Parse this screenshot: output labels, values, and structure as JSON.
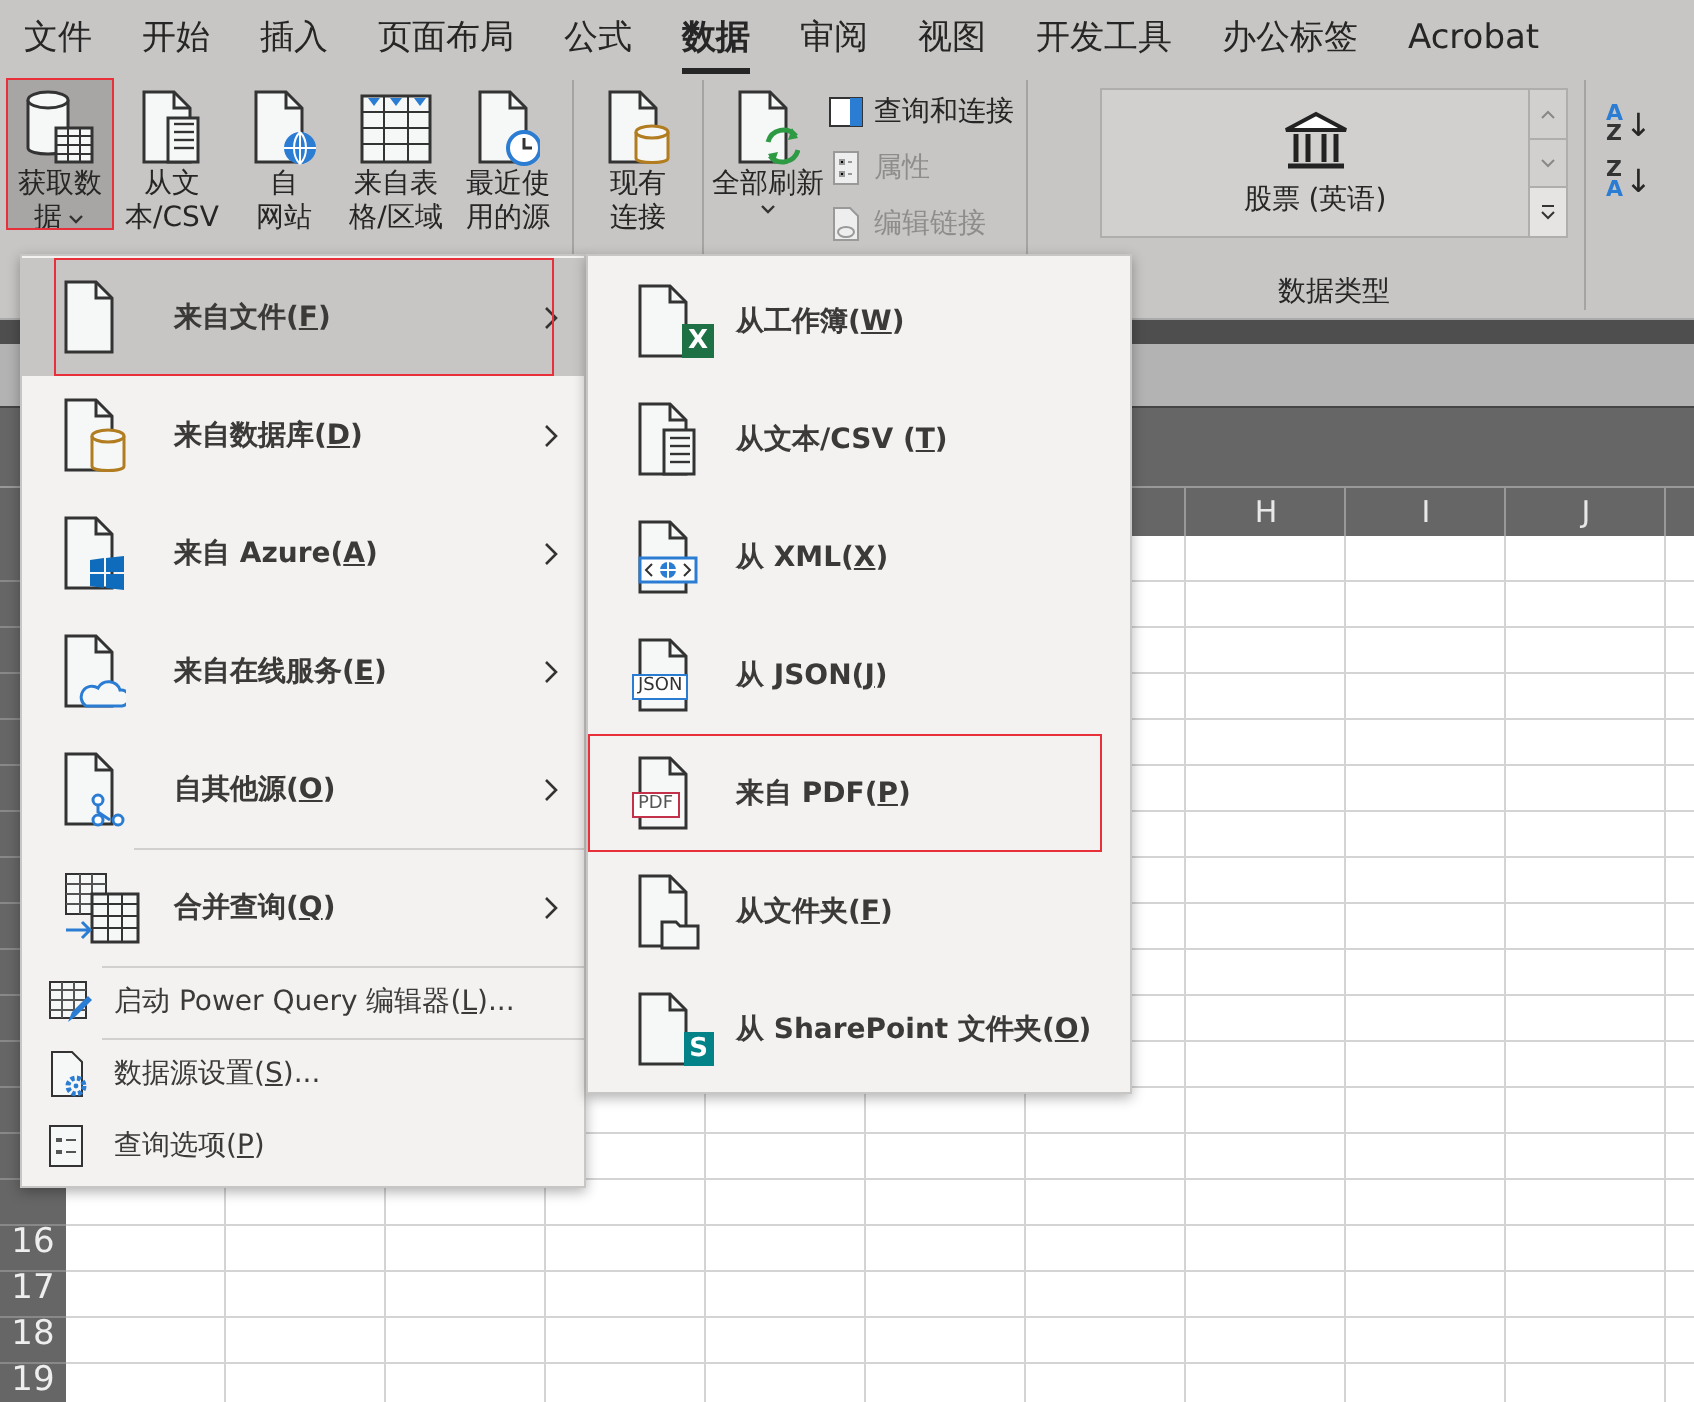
{
  "tabs": [
    {
      "label": "文件",
      "selected": false
    },
    {
      "label": "开始",
      "selected": false
    },
    {
      "label": "插入",
      "selected": false
    },
    {
      "label": "页面布局",
      "selected": false
    },
    {
      "label": "公式",
      "selected": false
    },
    {
      "label": "数据",
      "selected": true
    },
    {
      "label": "审阅",
      "selected": false
    },
    {
      "label": "视图",
      "selected": false
    },
    {
      "label": "开发工具",
      "selected": false
    },
    {
      "label": "办公标签",
      "selected": false
    },
    {
      "label": "Acrobat",
      "selected": false
    }
  ],
  "ribbon": {
    "groups": [
      {
        "buttons": [
          {
            "lines": [
              "获取数",
              "据"
            ],
            "dropdown": true,
            "selected": true,
            "outlined": true
          },
          {
            "lines": [
              "从文",
              "本/CSV"
            ],
            "dropdown": false,
            "selected": false,
            "outlined": false
          },
          {
            "lines": [
              "自",
              "网站"
            ],
            "dropdown": false,
            "selected": false,
            "outlined": false
          },
          {
            "lines": [
              "来自表",
              "格/区域"
            ],
            "dropdown": false,
            "selected": false,
            "outlined": false
          },
          {
            "lines": [
              "最近使",
              "用的源"
            ],
            "dropdown": false,
            "selected": false,
            "outlined": false
          }
        ]
      },
      {
        "buttons": [
          {
            "lines": [
              "现有",
              "连接"
            ],
            "dropdown": false,
            "selected": false,
            "outlined": false
          }
        ]
      },
      {
        "buttons": [
          {
            "lines": [
              "全部刷新"
            ],
            "dropdown": true,
            "selected": false,
            "outlined": false
          }
        ],
        "small_buttons": [
          {
            "label": "查询和连接",
            "disabled": false
          },
          {
            "label": "属性",
            "disabled": true
          },
          {
            "label": "编辑链接",
            "disabled": true
          }
        ]
      }
    ],
    "data_types": {
      "item": "股票 (英语)",
      "label": "数据类型"
    },
    "sort_buttons": [
      {
        "top": "A",
        "bottom": "Z",
        "arrow": "↓"
      },
      {
        "top": "Z",
        "bottom": "A",
        "arrow": "↓"
      }
    ]
  },
  "sheet": {
    "column_headers": [
      "H",
      "I",
      "J"
    ],
    "row_numbers": [
      "16",
      "17",
      "18",
      "19"
    ]
  },
  "menu": {
    "items": [
      {
        "kind": "large",
        "label": [
          "来自文件(",
          "F",
          ")"
        ],
        "has_submenu": true,
        "divider_before": false,
        "selected": true,
        "outlined": true
      },
      {
        "kind": "large",
        "label": [
          "来自数据库(",
          "D",
          ")"
        ],
        "has_submenu": true,
        "divider_before": false,
        "selected": false,
        "outlined": false
      },
      {
        "kind": "large",
        "label": [
          "来自 Azure(",
          "A",
          ")"
        ],
        "has_submenu": true,
        "divider_before": false,
        "selected": false,
        "outlined": false
      },
      {
        "kind": "large",
        "label": [
          "来自在线服务(",
          "E",
          ")"
        ],
        "has_submenu": true,
        "divider_before": false,
        "selected": false,
        "outlined": false
      },
      {
        "kind": "large",
        "label": [
          "自其他源(",
          "O",
          ")"
        ],
        "has_submenu": true,
        "divider_before": false,
        "selected": false,
        "outlined": false
      },
      {
        "kind": "large",
        "label": [
          "合并查询(",
          "Q",
          ")"
        ],
        "has_submenu": true,
        "divider_before": true,
        "selected": false,
        "outlined": false
      },
      {
        "kind": "small",
        "label": [
          "启动 Power Query 编辑器(",
          "L",
          ")..."
        ],
        "has_submenu": false,
        "divider_before": true,
        "selected": false,
        "outlined": false
      },
      {
        "kind": "small",
        "label": [
          "数据源设置(",
          "S",
          ")..."
        ],
        "has_submenu": false,
        "divider_before": true,
        "selected": false,
        "outlined": false
      },
      {
        "kind": "small",
        "label": [
          "查询选项(",
          "P",
          ")"
        ],
        "has_submenu": false,
        "divider_before": false,
        "selected": false,
        "outlined": false
      }
    ]
  },
  "submenu": {
    "items": [
      {
        "label": [
          "从工作簿(",
          "W",
          ")"
        ],
        "badge": "X",
        "outlined": false
      },
      {
        "label": [
          "从文本/CSV (",
          "T",
          ")"
        ],
        "outlined": false
      },
      {
        "label": [
          "从 XML(",
          "X",
          ")"
        ],
        "outlined": false
      },
      {
        "label": [
          "从 JSON(",
          "J",
          ")"
        ],
        "badge": "JSON",
        "outlined": false
      },
      {
        "label": [
          "来自 PDF(",
          "P",
          ")"
        ],
        "badge": "PDF",
        "outlined": true
      },
      {
        "label": [
          "从文件夹(",
          "F",
          ")"
        ],
        "outlined": false
      },
      {
        "label": [
          "从 SharePoint 文件夹(",
          "O",
          ")"
        ],
        "badge": "S",
        "outlined": false
      }
    ]
  }
}
